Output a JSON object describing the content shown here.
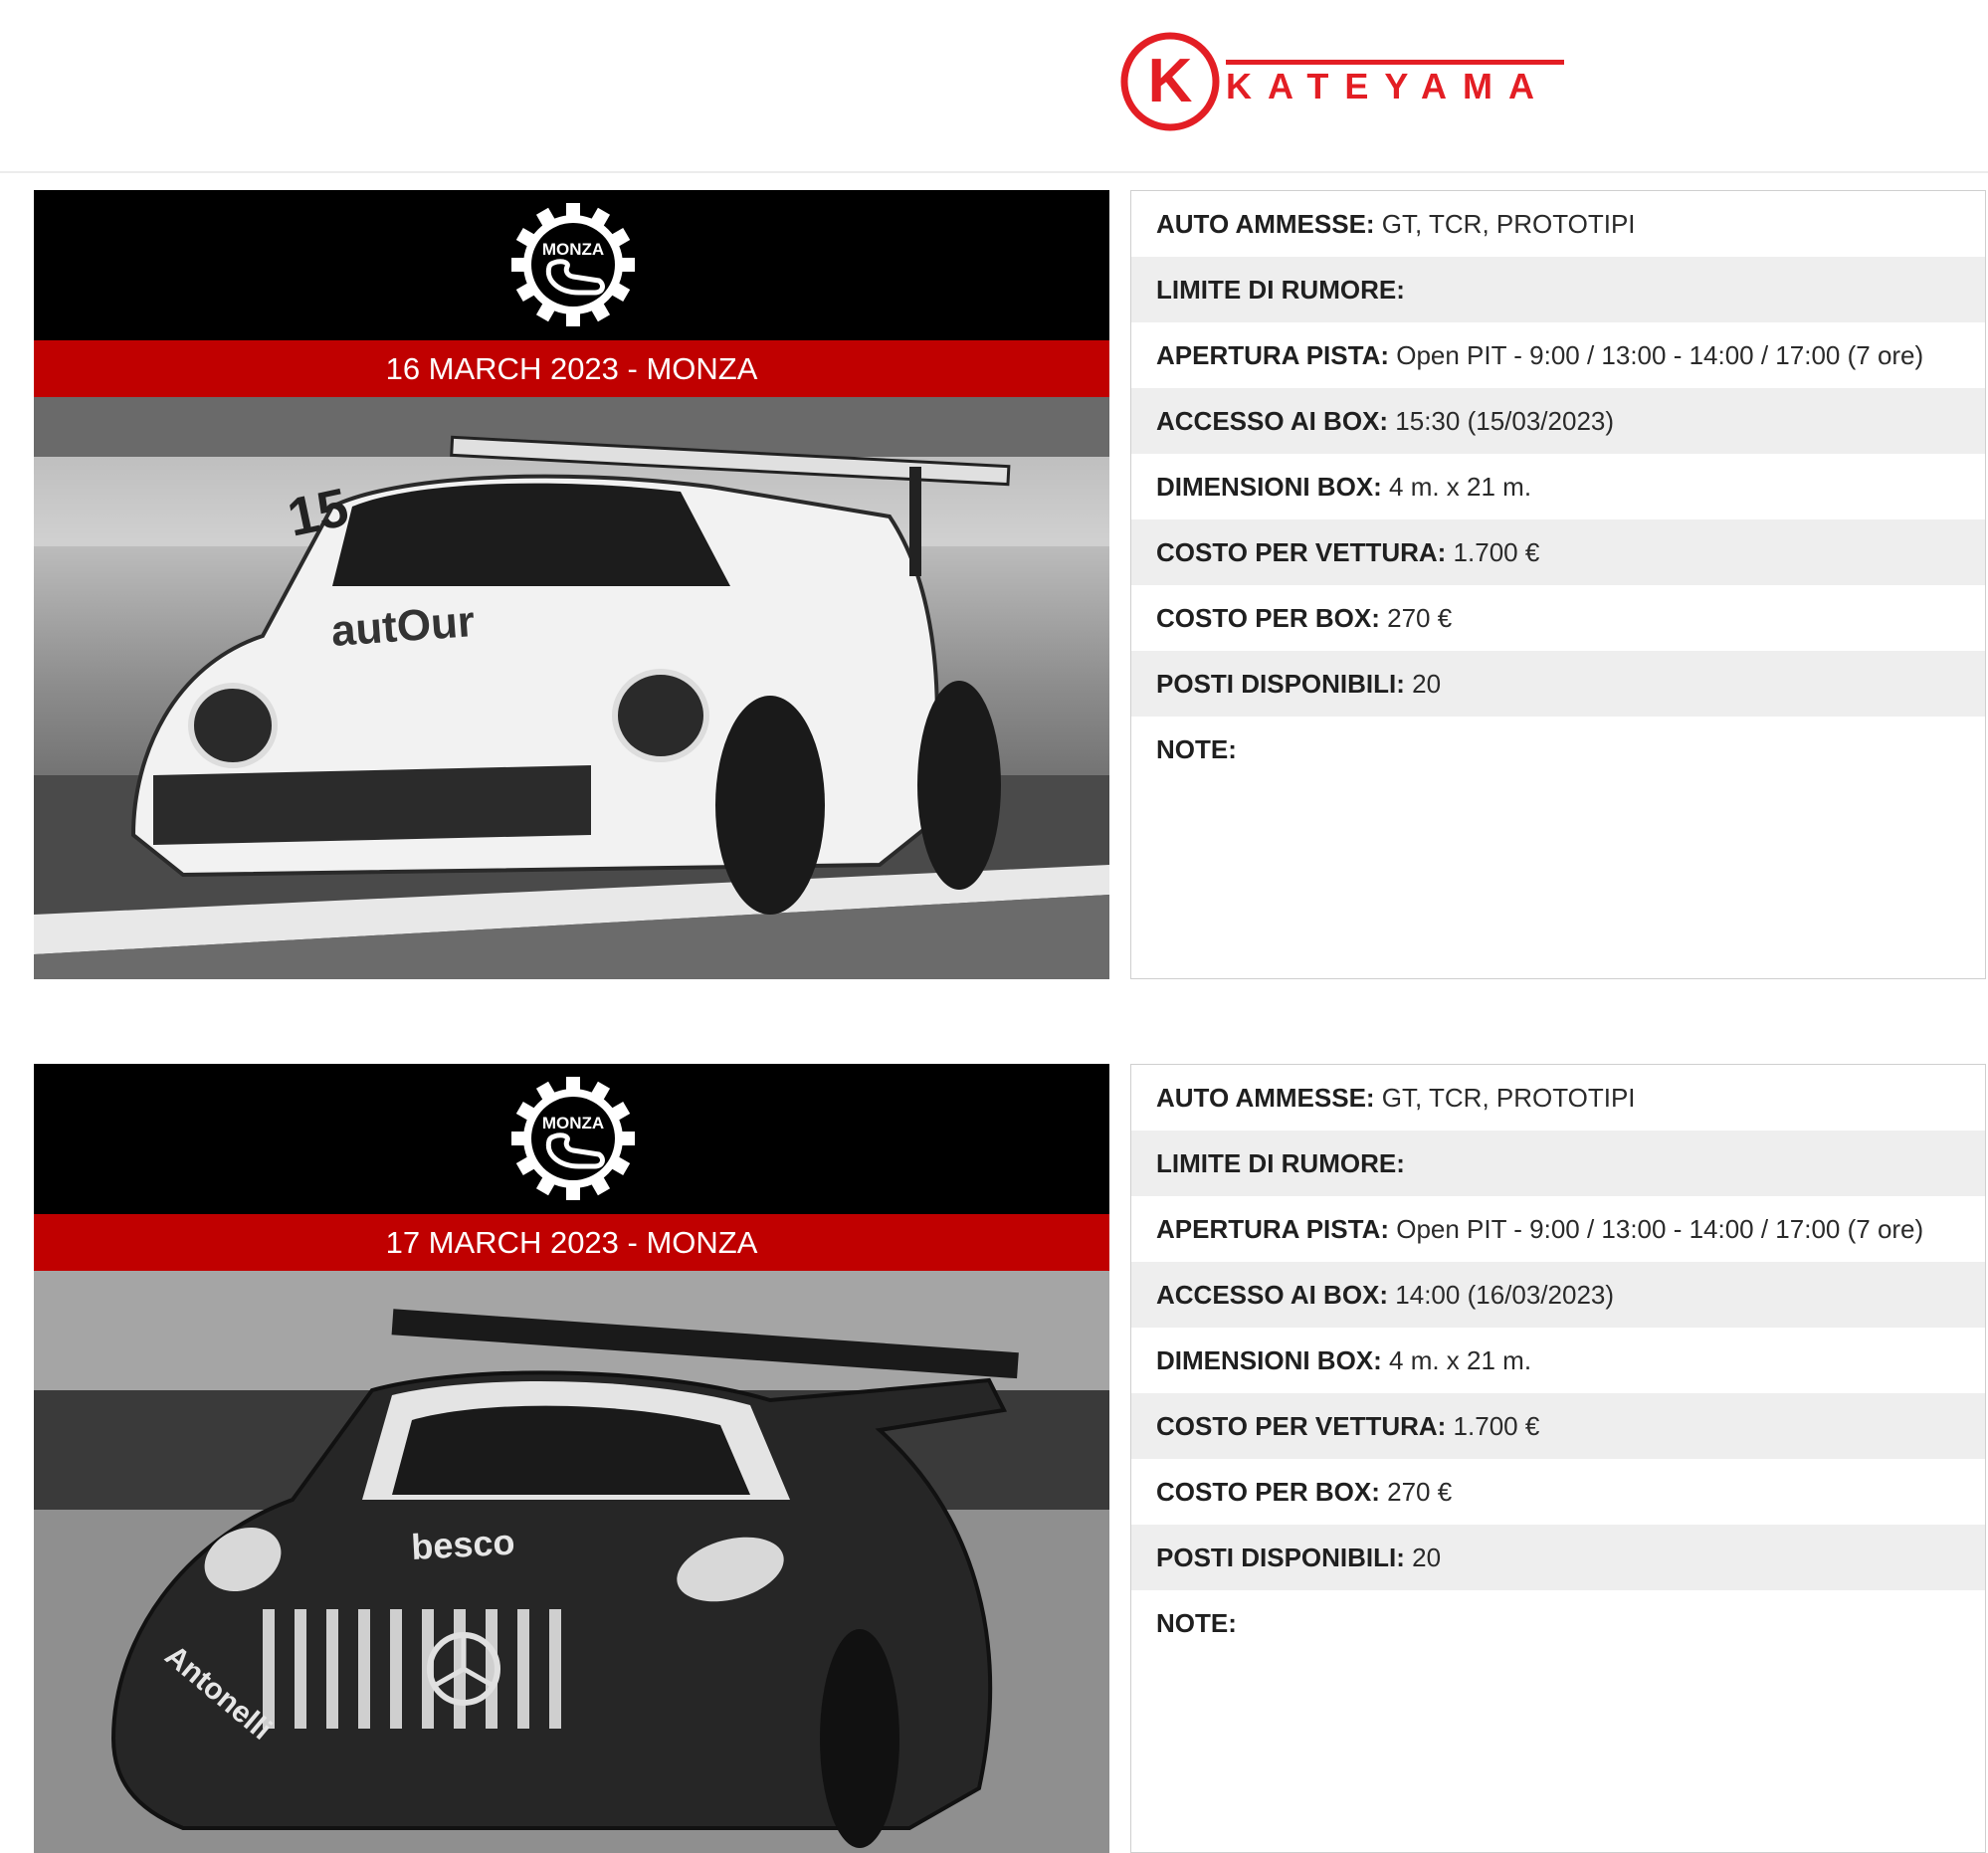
{
  "header": {
    "logo_letter": "K",
    "logo_text": "KATEYAMA",
    "brand_color": "#e31e24"
  },
  "events": [
    {
      "track_badge_text": "MONZA",
      "date_title": "16 MARCH 2023 - MONZA",
      "info": [
        {
          "label": "AUTO AMMESSE:",
          "value": " GT, TCR, PROTOTIPI"
        },
        {
          "label": "LIMITE DI RUMORE:",
          "value": ""
        },
        {
          "label": "APERTURA PISTA:",
          "value": " Open PIT - 9:00 / 13:00 - 14:00 / 17:00 (7 ore)"
        },
        {
          "label": "ACCESSO AI BOX:",
          "value": " 15:30 (15/03/2023)"
        },
        {
          "label": "DIMENSIONI BOX:",
          "value": " 4 m. x 21 m."
        },
        {
          "label": "COSTO PER VETTURA:",
          "value": " 1.700 €"
        },
        {
          "label": "COSTO PER BOX:",
          "value": " 270 €"
        },
        {
          "label": "POSTI DISPONIBILI:",
          "value": " 20"
        },
        {
          "label": "NOTE:",
          "value": ""
        }
      ]
    },
    {
      "track_badge_text": "MONZA",
      "date_title": "17 MARCH 2023 - MONZA",
      "info": [
        {
          "label": "AUTO AMMESSE:",
          "value": " GT, TCR, PROTOTIPI"
        },
        {
          "label": "LIMITE DI RUMORE:",
          "value": ""
        },
        {
          "label": "APERTURA PISTA:",
          "value": " Open PIT - 9:00 / 13:00 - 14:00 / 17:00 (7 ore)"
        },
        {
          "label": "ACCESSO AI BOX:",
          "value": " 14:00 (16/03/2023)"
        },
        {
          "label": "DIMENSIONI BOX:",
          "value": " 4 m. x 21 m."
        },
        {
          "label": "COSTO PER VETTURA:",
          "value": " 1.700 €"
        },
        {
          "label": "COSTO PER BOX:",
          "value": " 270 €"
        },
        {
          "label": "POSTI DISPONIBILI:",
          "value": " 20"
        },
        {
          "label": "NOTE:",
          "value": ""
        }
      ]
    }
  ],
  "colors": {
    "date_bar": "#c00000",
    "logo_bar": "#000000",
    "row_alt": "#eeeeee"
  }
}
